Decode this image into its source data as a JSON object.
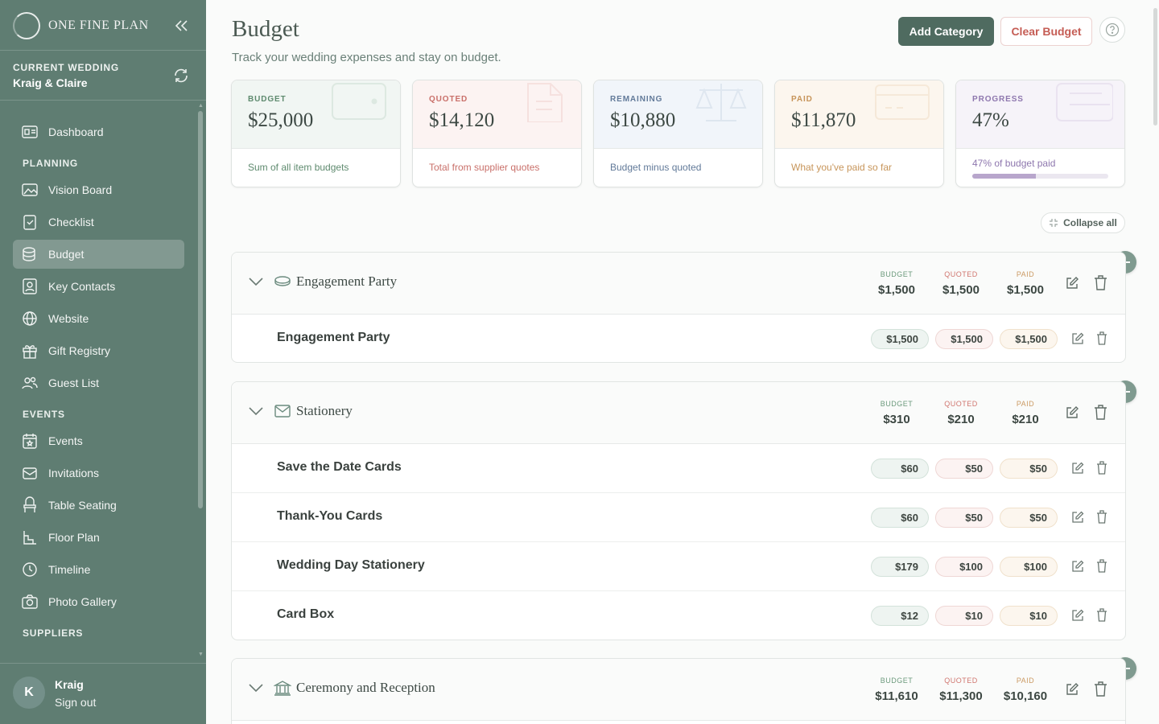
{
  "sidebar": {
    "brand": "ONE FINE PLAN",
    "current_wedding_label": "CURRENT WEDDING",
    "current_wedding_name": "Kraig & Claire",
    "dashboard": "Dashboard",
    "planning_head": "PLANNING",
    "planning": [
      "Vision Board",
      "Checklist",
      "Budget",
      "Key Contacts",
      "Website",
      "Gift Registry",
      "Guest List"
    ],
    "events_head": "EVENTS",
    "events": [
      "Events",
      "Invitations",
      "Table Seating",
      "Floor Plan",
      "Timeline",
      "Photo Gallery"
    ],
    "suppliers_head": "SUPPLIERS",
    "active_item": "Budget",
    "user_initial": "K",
    "user_name": "Kraig",
    "sign_out": "Sign out"
  },
  "header": {
    "title": "Budget",
    "subtitle": "Track your wedding expenses and stay on budget.",
    "add_category": "Add Category",
    "clear_budget": "Clear Budget"
  },
  "stats": [
    {
      "label": "BUDGET",
      "value": "$25,000",
      "foot": "Sum of all item budgets",
      "color": "#5e8a6e",
      "bg": "#f1f6f3"
    },
    {
      "label": "QUOTED",
      "value": "$14,120",
      "foot": "Total from supplier quotes",
      "color": "#c9706a",
      "bg": "#fcf3f2"
    },
    {
      "label": "REMAINING",
      "value": "$10,880",
      "foot": "Budget minus quoted",
      "color": "#627a99",
      "bg": "#f1f5fa"
    },
    {
      "label": "PAID",
      "value": "$11,870",
      "foot": "What you've paid so far",
      "color": "#c7955a",
      "bg": "#fcf6ee"
    },
    {
      "label": "PROGRESS",
      "value": "47%",
      "foot": "47% of budget paid",
      "color": "#8e77ae",
      "bg": "#f6f3f9",
      "progress": 0.47
    }
  ],
  "collapse_all": "Collapse all",
  "totals_labels": {
    "budget": "BUDGET",
    "quoted": "QUOTED",
    "paid": "PAID"
  },
  "categories": [
    {
      "name": "Engagement Party",
      "icon": "ring-icon",
      "budget": "$1,500",
      "quoted": "$1,500",
      "paid": "$1,500",
      "items": [
        {
          "name": "Engagement Party",
          "budget": "$1,500",
          "quoted": "$1,500",
          "paid": "$1,500"
        }
      ]
    },
    {
      "name": "Stationery",
      "icon": "envelope-icon",
      "budget": "$310",
      "quoted": "$210",
      "paid": "$210",
      "items": [
        {
          "name": "Save the Date Cards",
          "budget": "$60",
          "quoted": "$50",
          "paid": "$50"
        },
        {
          "name": "Thank-You Cards",
          "budget": "$60",
          "quoted": "$50",
          "paid": "$50"
        },
        {
          "name": "Wedding Day Stationery",
          "budget": "$179",
          "quoted": "$100",
          "paid": "$100"
        },
        {
          "name": "Card Box",
          "budget": "$12",
          "quoted": "$10",
          "paid": "$10"
        }
      ]
    },
    {
      "name": "Ceremony and Reception",
      "icon": "venue-icon",
      "budget": "$11,610",
      "quoted": "$11,300",
      "paid": "$10,160",
      "items": []
    }
  ]
}
